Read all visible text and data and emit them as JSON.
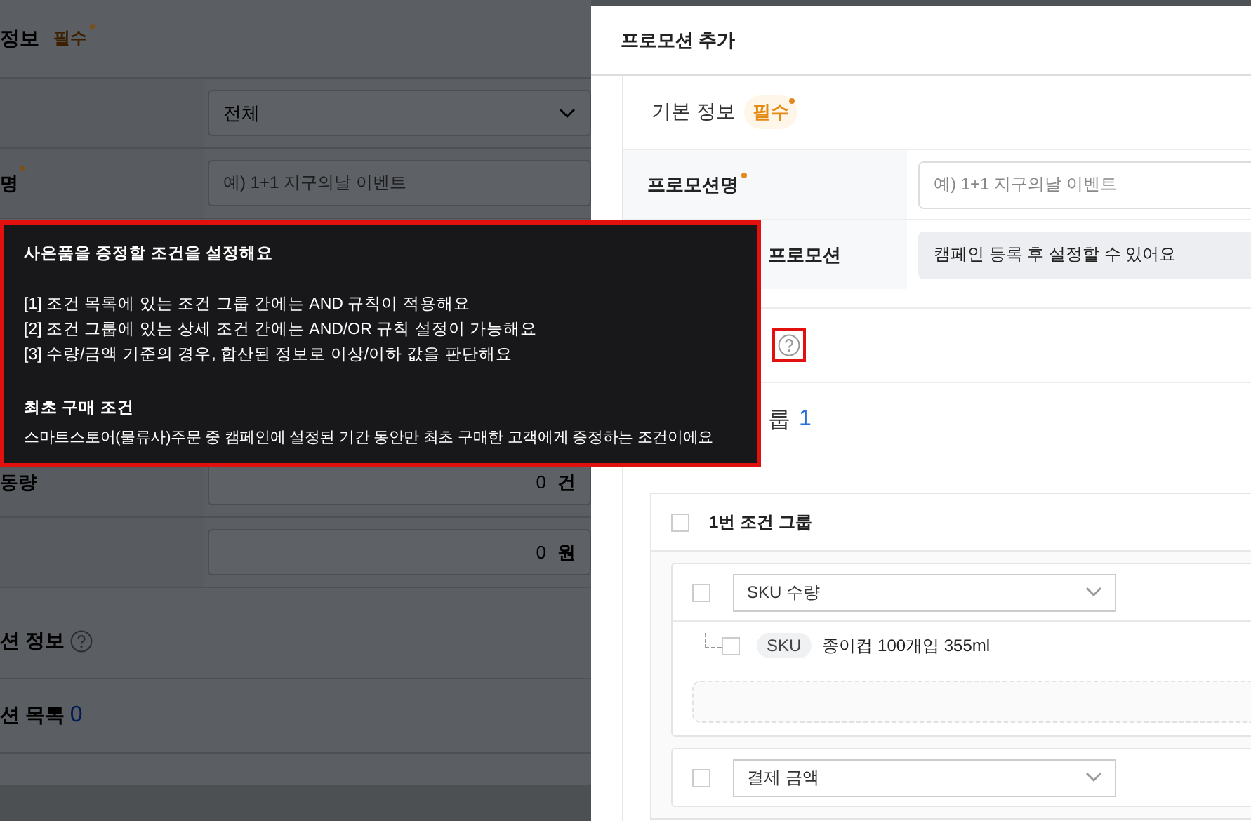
{
  "background_page": {
    "section_title": "정보",
    "section_badge": "필수",
    "rows": [
      {
        "kind": "select",
        "value": "전체",
        "required": false
      },
      {
        "kind": "input",
        "label": "명",
        "required": true,
        "placeholder": "예) 1+1 지구의날 이벤트"
      },
      {
        "kind": "number",
        "label": "동량",
        "value": "0",
        "unit": "건",
        "required": false
      },
      {
        "kind": "number",
        "value": "0",
        "unit": "원",
        "required": false
      }
    ],
    "info_title": "션 정보",
    "list_title": "션 목록",
    "list_count": "0"
  },
  "modal": {
    "title": "프로모션 추가",
    "section_title": "기본 정보",
    "section_badge": "필수",
    "rows": [
      {
        "kind": "input",
        "label": "프로모션명",
        "required": true,
        "placeholder": "예) 1+1 지구의날 이벤트"
      },
      {
        "kind": "disabled",
        "label": "프로모션",
        "required": false,
        "value": "캠페인 등록 후 설정할 수 있어요"
      }
    ],
    "condition_help_highlighted": true,
    "group_label": "룹",
    "group_count": "1",
    "groups": [
      {
        "title": "1번 조건 그룹",
        "checked": false,
        "conditions": [
          {
            "type": "SKU 수량",
            "checked": false,
            "items": [
              {
                "tag": "SKU",
                "name": "종이컵 100개입 355ml",
                "checked": false
              }
            ]
          },
          {
            "type": "결제 금액",
            "checked": false
          }
        ]
      }
    ]
  },
  "tooltip": {
    "highlighted": true,
    "title": "사은품을 증정할 조건을 설정해요",
    "rules": [
      "[1] 조건 목록에 있는 조건 그룹 간에는 AND 규칙이 적용해요",
      "[2] 조건 그룹에 있는 상세 조건 간에는 AND/OR 규칙 설정이 가능해요",
      "[3] 수량/금액 기준의 경우, 합산된 정보로 이상/이하 값을 판단해요"
    ],
    "subtitle": "최초 구매 조건",
    "description": "스마트스토어(물류사)주문 중 캠페인에 설정된 기간 동안만 최초 구매한 고객에게 증정하는 조건이에요"
  }
}
